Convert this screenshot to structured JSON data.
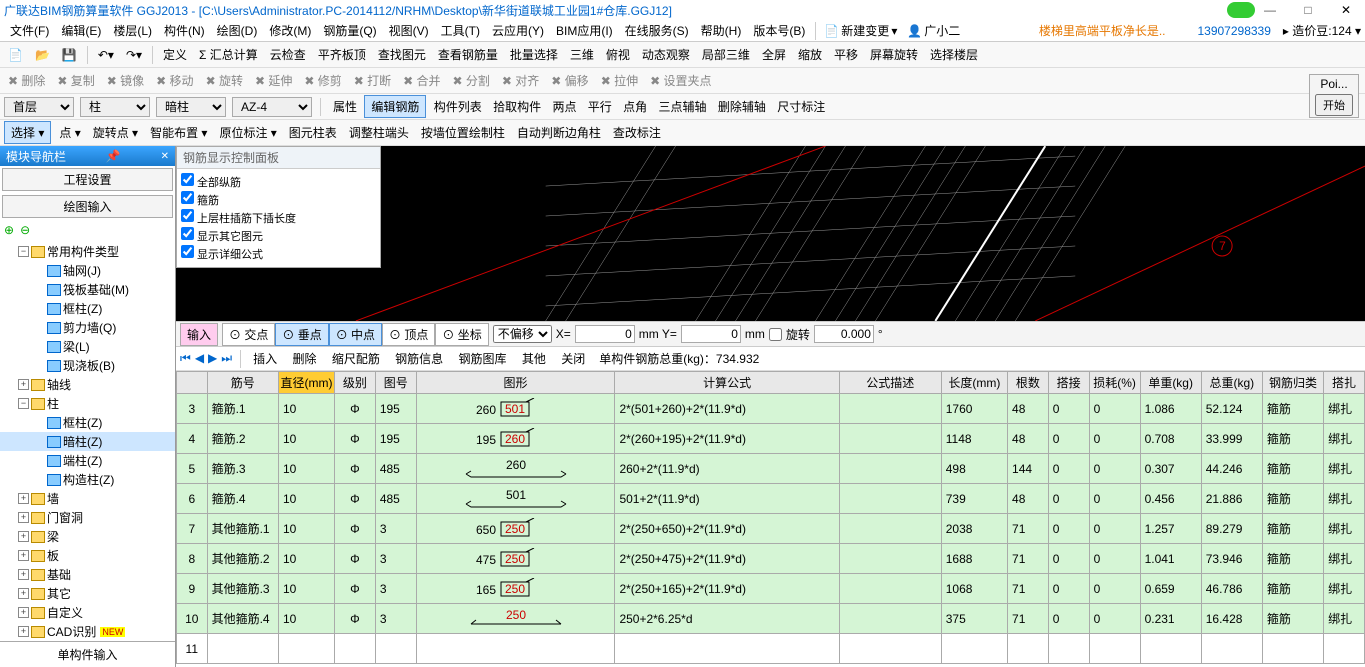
{
  "title": "广联达BIM钢筋算量软件 GGJ2013 - [C:\\Users\\Administrator.PC-2014112/NRHM\\Desktop\\新华街道联城工业园1#仓库.GGJ12]",
  "menus": [
    "文件(F)",
    "编辑(E)",
    "楼层(L)",
    "构件(N)",
    "绘图(D)",
    "修改(M)",
    "钢筋量(Q)",
    "视图(V)",
    "工具(T)",
    "云应用(Y)",
    "BIM应用(I)",
    "在线服务(S)",
    "帮助(H)",
    "版本号(B)"
  ],
  "menu_right": {
    "new_change": "新建变更",
    "user": "广小二",
    "note": "楼梯里高端平板净长是..",
    "phone": "13907298339",
    "credits_label": "造价豆:",
    "credits": "124"
  },
  "toolbar2": [
    "定义",
    "Σ 汇总计算",
    "云检查",
    "平齐板顶",
    "查找图元",
    "查看钢筋量",
    "批量选择",
    "三维",
    "俯视",
    "动态观察",
    "局部三维",
    "全屏",
    "缩放",
    "平移",
    "屏幕旋转",
    "选择楼层"
  ],
  "toolbar3": {
    "grey": [
      "删除",
      "复制",
      "镜像",
      "移动",
      "旋转",
      "延伸",
      "修剪",
      "打断",
      "合并",
      "分割",
      "对齐",
      "偏移",
      "拉伸",
      "设置夹点"
    ]
  },
  "sel_row": {
    "floor": "首层",
    "type": "柱",
    "sub": "暗柱",
    "code": "AZ-4",
    "btns": [
      "属性",
      "编辑钢筋",
      "构件列表",
      "拾取构件",
      "两点",
      "平行",
      "点角",
      "三点辅轴",
      "删除辅轴",
      "尺寸标注"
    ]
  },
  "sel_row2": [
    "选择",
    "点",
    "旋转点",
    "智能布置",
    "原位标注",
    "图元柱表",
    "调整柱端头",
    "按墙位置绘制柱",
    "自动判断边角柱",
    "查改标注"
  ],
  "poi": {
    "label": "Poi...",
    "btn": "开始"
  },
  "nav": {
    "title": "模块导航栏",
    "sec1": "工程设置",
    "sec2": "绘图输入",
    "bottom": "单构件输入"
  },
  "tree": [
    {
      "t": "常用构件类型",
      "lvl": 1,
      "open": true,
      "folder": true
    },
    {
      "t": "轴网(J)",
      "lvl": 2,
      "icon": "grid"
    },
    {
      "t": "筏板基础(M)",
      "lvl": 2,
      "icon": "raft"
    },
    {
      "t": "框柱(Z)",
      "lvl": 2,
      "icon": "col"
    },
    {
      "t": "剪力墙(Q)",
      "lvl": 2,
      "icon": "wall"
    },
    {
      "t": "梁(L)",
      "lvl": 2,
      "icon": "beam"
    },
    {
      "t": "现浇板(B)",
      "lvl": 2,
      "icon": "slab"
    },
    {
      "t": "轴线",
      "lvl": 1,
      "open": false,
      "folder": true
    },
    {
      "t": "柱",
      "lvl": 1,
      "open": true,
      "folder": true
    },
    {
      "t": "框柱(Z)",
      "lvl": 2,
      "icon": "col"
    },
    {
      "t": "暗柱(Z)",
      "lvl": 2,
      "icon": "col",
      "sel": true
    },
    {
      "t": "端柱(Z)",
      "lvl": 2,
      "icon": "col"
    },
    {
      "t": "构造柱(Z)",
      "lvl": 2,
      "icon": "col"
    },
    {
      "t": "墙",
      "lvl": 1,
      "open": false,
      "folder": true
    },
    {
      "t": "门窗洞",
      "lvl": 1,
      "open": false,
      "folder": true
    },
    {
      "t": "梁",
      "lvl": 1,
      "open": false,
      "folder": true
    },
    {
      "t": "板",
      "lvl": 1,
      "open": false,
      "folder": true
    },
    {
      "t": "基础",
      "lvl": 1,
      "open": false,
      "folder": true
    },
    {
      "t": "其它",
      "lvl": 1,
      "open": false,
      "folder": true
    },
    {
      "t": "自定义",
      "lvl": 1,
      "open": false,
      "folder": true
    },
    {
      "t": "CAD识别",
      "lvl": 1,
      "open": false,
      "folder": true,
      "new": true
    }
  ],
  "cp": {
    "header": "钢筋显示控制面板",
    "items": [
      "全部纵筋",
      "箍筋",
      "上层柱插筋下插长度",
      "显示其它图元",
      "显示详细公式"
    ]
  },
  "snap": {
    "input_label": "输入",
    "items": [
      "交点",
      "垂点",
      "中点",
      "顶点",
      "坐标"
    ],
    "offset_label": "不偏移",
    "x_label": "X=",
    "x": "0",
    "y_label": "mm Y=",
    "y": "0",
    "mm": "mm",
    "rotate_label": "旋转",
    "rotate": "0.000"
  },
  "rebar_bar": {
    "btns": [
      "插入",
      "删除",
      "缩尺配筋",
      "钢筋信息",
      "钢筋图库",
      "其他",
      "关闭"
    ],
    "info": "单构件钢筋总重(kg)：734.932"
  },
  "table": {
    "headers": [
      "",
      "筋号",
      "直径(mm)",
      "级别",
      "图号",
      "图形",
      "计算公式",
      "公式描述",
      "长度(mm)",
      "根数",
      "搭接",
      "损耗(%)",
      "单重(kg)",
      "总重(kg)",
      "钢筋归类",
      "搭扎"
    ],
    "rows": [
      {
        "idx": "3",
        "name": "箍筋.1",
        "dia": "10",
        "grade": "Φ",
        "num": "195",
        "shape": {
          "a": "260",
          "b": "501"
        },
        "formula": "2*(501+260)+2*(11.9*d)",
        "desc": "",
        "len": "1760",
        "cnt": "48",
        "lap": "0",
        "loss": "0",
        "uw": "1.086",
        "tw": "52.124",
        "cat": "箍筋",
        "tie": "绑扎"
      },
      {
        "idx": "4",
        "name": "箍筋.2",
        "dia": "10",
        "grade": "Φ",
        "num": "195",
        "shape": {
          "a": "195",
          "b": "260"
        },
        "formula": "2*(260+195)+2*(11.9*d)",
        "desc": "",
        "len": "1148",
        "cnt": "48",
        "lap": "0",
        "loss": "0",
        "uw": "0.708",
        "tw": "33.999",
        "cat": "箍筋",
        "tie": "绑扎"
      },
      {
        "idx": "5",
        "name": "箍筋.3",
        "dia": "10",
        "grade": "Φ",
        "num": "485",
        "shape": {
          "a": "260",
          "type": "wide"
        },
        "formula": "260+2*(11.9*d)",
        "desc": "",
        "len": "498",
        "cnt": "144",
        "lap": "0",
        "loss": "0",
        "uw": "0.307",
        "tw": "44.246",
        "cat": "箍筋",
        "tie": "绑扎"
      },
      {
        "idx": "6",
        "name": "箍筋.4",
        "dia": "10",
        "grade": "Φ",
        "num": "485",
        "shape": {
          "a": "501",
          "type": "wide"
        },
        "formula": "501+2*(11.9*d)",
        "desc": "",
        "len": "739",
        "cnt": "48",
        "lap": "0",
        "loss": "0",
        "uw": "0.456",
        "tw": "21.886",
        "cat": "箍筋",
        "tie": "绑扎"
      },
      {
        "idx": "7",
        "name": "其他箍筋.1",
        "dia": "10",
        "grade": "Φ",
        "num": "3",
        "shape": {
          "a": "650",
          "b": "250"
        },
        "formula": "2*(250+650)+2*(11.9*d)",
        "desc": "",
        "len": "2038",
        "cnt": "71",
        "lap": "0",
        "loss": "0",
        "uw": "1.257",
        "tw": "89.279",
        "cat": "箍筋",
        "tie": "绑扎"
      },
      {
        "idx": "8",
        "name": "其他箍筋.2",
        "dia": "10",
        "grade": "Φ",
        "num": "3",
        "shape": {
          "a": "475",
          "b": "250"
        },
        "formula": "2*(250+475)+2*(11.9*d)",
        "desc": "",
        "len": "1688",
        "cnt": "71",
        "lap": "0",
        "loss": "0",
        "uw": "1.041",
        "tw": "73.946",
        "cat": "箍筋",
        "tie": "绑扎"
      },
      {
        "idx": "9",
        "name": "其他箍筋.3",
        "dia": "10",
        "grade": "Φ",
        "num": "3",
        "shape": {
          "a": "165",
          "b": "250"
        },
        "formula": "2*(250+165)+2*(11.9*d)",
        "desc": "",
        "len": "1068",
        "cnt": "71",
        "lap": "0",
        "loss": "0",
        "uw": "0.659",
        "tw": "46.786",
        "cat": "箍筋",
        "tie": "绑扎"
      },
      {
        "idx": "10",
        "name": "其他箍筋.4",
        "dia": "10",
        "grade": "Φ",
        "num": "3",
        "shape": {
          "a": "250",
          "type": "line"
        },
        "formula": "250+2*6.25*d",
        "desc": "",
        "len": "375",
        "cnt": "71",
        "lap": "0",
        "loss": "0",
        "uw": "0.231",
        "tw": "16.428",
        "cat": "箍筋",
        "tie": "绑扎"
      },
      {
        "idx": "11",
        "empty": true
      }
    ]
  }
}
